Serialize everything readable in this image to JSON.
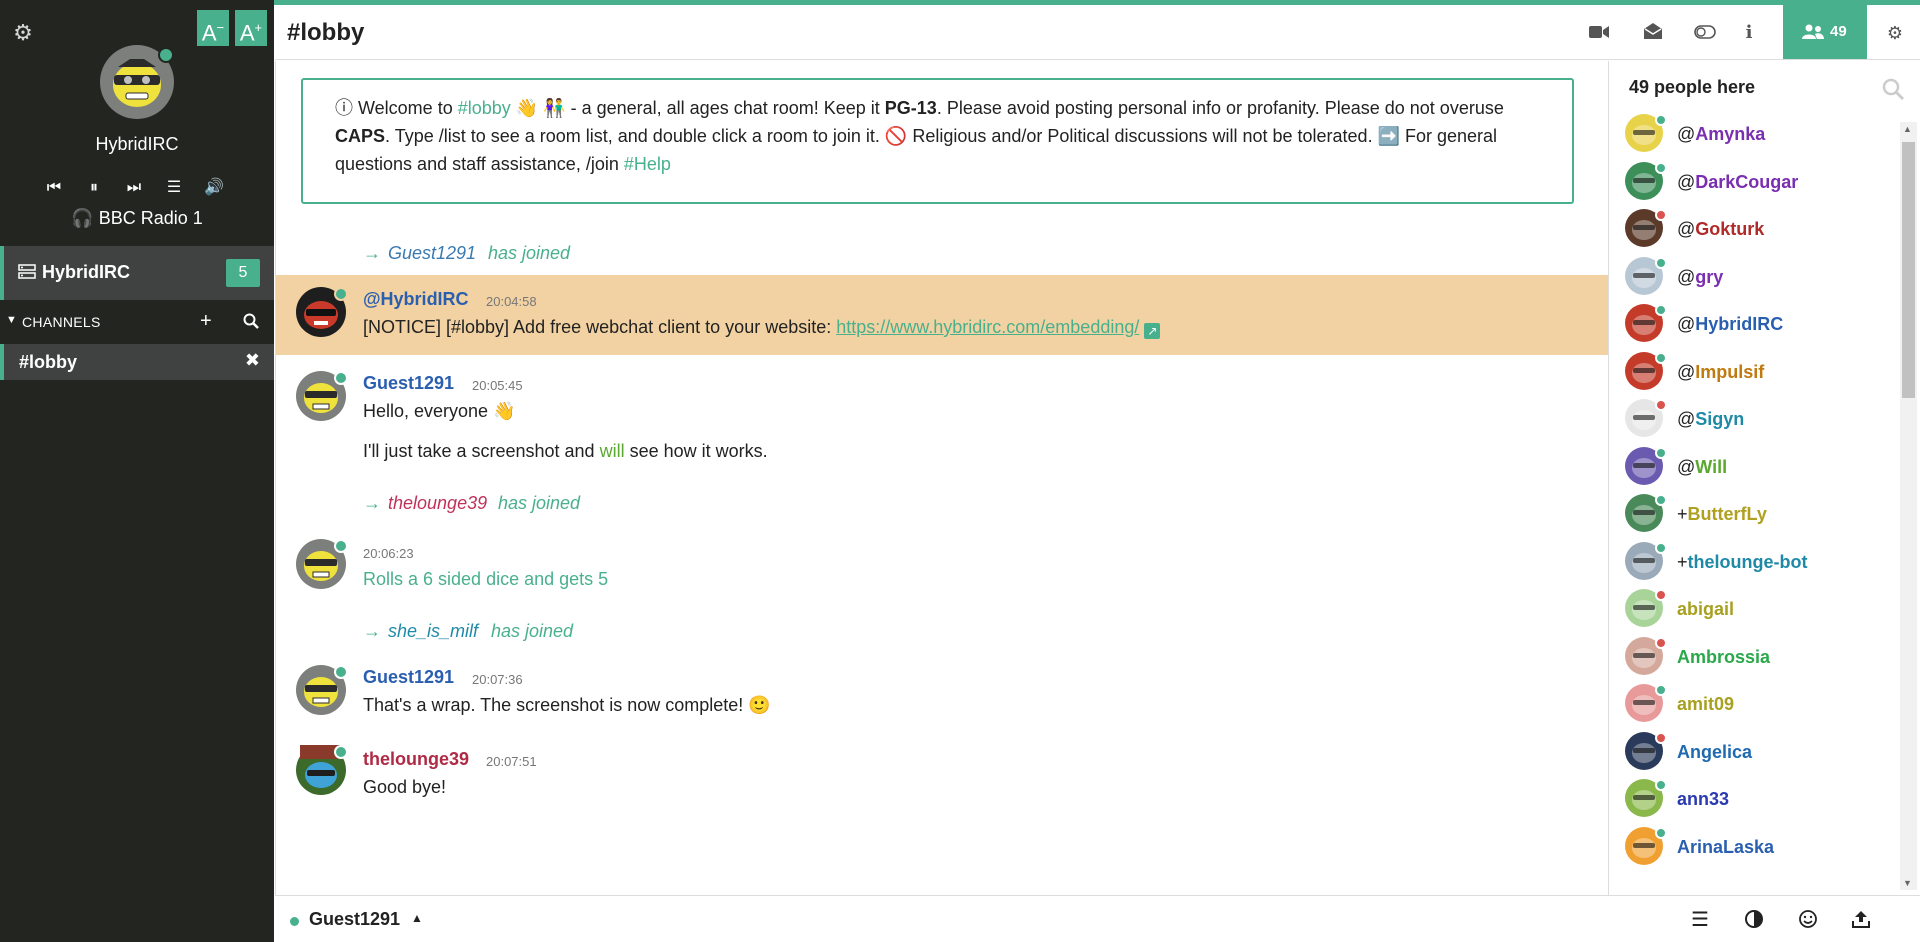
{
  "app": {
    "accent_color": "#49b08d"
  },
  "sidebar": {
    "settings_icon": "gear-icon",
    "font_decrease": "A",
    "font_decrease_sup": "−",
    "font_increase": "A",
    "font_increase_sup": "+",
    "username": "HybridIRC",
    "radio_station": "BBC Radio 1",
    "network": {
      "name": "HybridIRC",
      "badge": "5"
    },
    "channels_label": "CHANNELS",
    "channels": [
      {
        "name": "#lobby"
      }
    ]
  },
  "header": {
    "channel_title": "#lobby",
    "user_count": "49"
  },
  "topic": {
    "p1": "ⓘ Welcome to ",
    "chan": "#lobby",
    "emoji1": "👋 👫",
    "p2": " - a general, all ages chat room! Keep it ",
    "pg": "PG-13",
    "p3": ". Please avoid posting personal info or profanity. Please do not overuse ",
    "caps": "CAPS",
    "p4": ". Type /list to see a room list, and double click a room to join it. 🚫 Religious and/or Political discussions will not be tolerated. ➡️ For general questions and staff assistance, /join ",
    "help": "#Help"
  },
  "messages": [
    {
      "type": "join",
      "arrow": "→",
      "nick": "Guest1291",
      "action": "has joined"
    },
    {
      "type": "notice",
      "nick": "@HybridIRC",
      "time": "20:04:58",
      "text": "[NOTICE] [#lobby] Add free webchat client to your website: ",
      "link": "https://www.hybridirc.com/embedding/"
    },
    {
      "type": "message",
      "nick": "Guest1291",
      "time": "20:05:45",
      "text": "Hello, everyone 👋",
      "text2a": "I'll just take a screenshot and ",
      "text2b": "will",
      "text2c": " see how it works."
    },
    {
      "type": "join",
      "arrow": "→",
      "nick": "thelounge39",
      "action": "has joined"
    },
    {
      "type": "action",
      "time": "20:06:23",
      "text": "Rolls a 6 sided dice and gets 5"
    },
    {
      "type": "join",
      "arrow": "→",
      "nick": "she_is_milf",
      "action": "has joined"
    },
    {
      "type": "message",
      "nick": "Guest1291",
      "time": "20:07:36",
      "text": "That's a wrap. The screenshot is now complete! 🙂"
    },
    {
      "type": "message",
      "nick": "thelounge39",
      "time": "20:07:51",
      "text": "Good bye!"
    }
  ],
  "userlist": {
    "header": "49 people here",
    "users": [
      {
        "mode": "@",
        "nick": "Amynka",
        "color": "#7a2fb0",
        "status": "#49b08d",
        "avatar": "#e8d24a"
      },
      {
        "mode": "@",
        "nick": "DarkCougar",
        "color": "#7a2fb0",
        "status": "#49b08d",
        "avatar": "#3d8f5a"
      },
      {
        "mode": "@",
        "nick": "Gokturk",
        "color": "#b02a2a",
        "status": "#d9534f",
        "avatar": "#5b3a2a"
      },
      {
        "mode": "@",
        "nick": "gry",
        "color": "#7a2fb0",
        "status": "#49b08d",
        "avatar": "#b8c7d4"
      },
      {
        "mode": "@",
        "nick": "HybridIRC",
        "color": "#2a5fb0",
        "status": "#49b08d",
        "avatar": "#c43b2a"
      },
      {
        "mode": "@",
        "nick": "Impulsif",
        "color": "#c07a10",
        "status": "#49b08d",
        "avatar": "#c43b2a"
      },
      {
        "mode": "@",
        "nick": "Sigyn",
        "color": "#1f8aa8",
        "status": "#d9534f",
        "avatar": "#e6e6e6"
      },
      {
        "mode": "@",
        "nick": "Will",
        "color": "#5aa82f",
        "status": "#49b08d",
        "avatar": "#6b5bb0"
      },
      {
        "mode": "+",
        "nick": "ButterfLy",
        "color": "#b0a020",
        "status": "#49b08d",
        "avatar": "#4a8a5a"
      },
      {
        "mode": "+",
        "nick": "thelounge-bot",
        "color": "#1f8aa8",
        "status": "#49b08d",
        "avatar": "#9aaab8"
      },
      {
        "mode": "",
        "nick": "abigail",
        "color": "#a8a020",
        "status": "#d9534f",
        "avatar": "#a8d49a"
      },
      {
        "mode": "",
        "nick": "Ambrossia",
        "color": "#2aa84a",
        "status": "#d9534f",
        "avatar": "#d4a89a"
      },
      {
        "mode": "",
        "nick": "amit09",
        "color": "#a8a020",
        "status": "#49b08d",
        "avatar": "#e89a9a"
      },
      {
        "mode": "",
        "nick": "Angelica",
        "color": "#1f6ab0",
        "status": "#d9534f",
        "avatar": "#2a3a5a"
      },
      {
        "mode": "",
        "nick": "ann33",
        "color": "#2a3ab0",
        "status": "#49b08d",
        "avatar": "#8ab84a"
      },
      {
        "mode": "",
        "nick": "ArinaLaska",
        "color": "#2a5fb0",
        "status": "#49b08d",
        "avatar": "#f0a030"
      }
    ]
  },
  "footer": {
    "nick": "Guest1291"
  }
}
